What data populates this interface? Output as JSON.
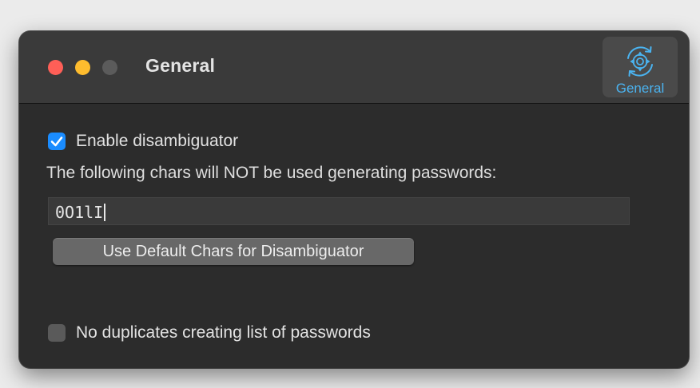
{
  "window": {
    "title": "General"
  },
  "toolbar": {
    "general_label": "General",
    "general_icon": "gear-sync-icon",
    "accent_color": "#4ab3f0"
  },
  "settings": {
    "enable_disambiguator": {
      "label": "Enable disambiguator",
      "checked": true
    },
    "info_text": "The following chars will NOT be used generating passwords:",
    "excluded_chars": "0O1lI",
    "default_button_label": "Use Default Chars for Disambiguator",
    "no_duplicates": {
      "label": "No duplicates creating list of passwords",
      "checked": false
    }
  },
  "colors": {
    "close": "#ff5f57",
    "minimize": "#febc2e",
    "zoom_disabled": "#5b5b5b",
    "checkbox_on": "#1a8cff"
  }
}
